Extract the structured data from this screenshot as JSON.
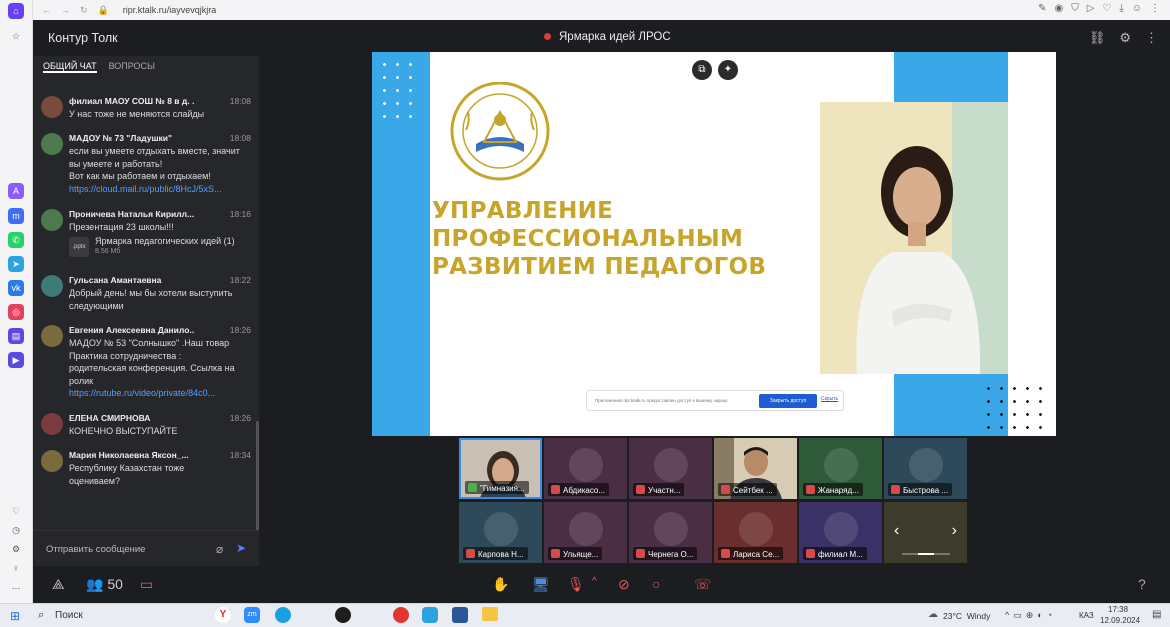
{
  "browser": {
    "url": "ripr.ktalk.ru/iayvevqjkjra"
  },
  "app": {
    "name": "Контур Толк",
    "meeting_title": "Ярмарка идей ЛРОС"
  },
  "chat": {
    "tabs": [
      "ОБЩИЙ ЧАТ",
      "ВОПРОСЫ"
    ],
    "messages": [
      {
        "name": "филиал МАОУ СОШ № 8 в д. ...",
        "time": "18:08",
        "lines": [
          "У нас тоже не меняются слайды"
        ],
        "link": "",
        "avatar_color": "#7a4a3d"
      },
      {
        "name": "МАДОУ № 73 \"Ладушки\"",
        "time": "18:08",
        "lines": [
          "если вы умеете отдыхать вместе, значит",
          "вы умеете и работать!",
          "Вот как мы работаем и отдыхаем!"
        ],
        "link": "https://cloud.mail.ru/public/8HcJ/5xS...",
        "avatar_color": "#4c7a4d"
      },
      {
        "name": "Проничева Наталья Кирилл...",
        "time": "18:16",
        "lines": [
          "Презентация 23 школы!!!"
        ],
        "link": "",
        "avatar_color": "#4c7a4d",
        "attachment": {
          "ext": ".pptx",
          "title": "Ярмарка педагогических идей (1)",
          "size": "8.56 Мб"
        }
      },
      {
        "name": "Гульсана Амантаевна",
        "time": "18:22",
        "lines": [
          "Добрый день! мы бы хотели выступить",
          "следующими"
        ],
        "link": "",
        "avatar_color": "#3d7a78"
      },
      {
        "name": "Евгения Алексеевна Данило...",
        "time": "18:26",
        "lines": [
          "МАДОУ № 53 \"Солнышко\" .Наш товар",
          "Практика сотрудничества :",
          "родительская конференция. Ссылка на",
          "ролик"
        ],
        "link": "https://rutube.ru/video/private/84c0...",
        "avatar_color": "#7a6a3d"
      },
      {
        "name": "ЕЛЕНА СМИРНОВА",
        "time": "18:26",
        "lines": [
          "КОНЕЧНО ВЫСТУПАЙТЕ"
        ],
        "link": "",
        "avatar_color": "#7a3d3d"
      },
      {
        "name": "Мария Николаевна Яксон_...",
        "time": "18:34",
        "lines": [
          "Республику Казахстан тоже",
          "оцениваем?"
        ],
        "link": "",
        "avatar_color": "#7a6a3d"
      }
    ],
    "reactions": [
      "👍",
      "👎",
      "👏",
      "😂",
      "😭",
      "🤩",
      "😞"
    ],
    "send_placeholder": "Отправить сообщение"
  },
  "slide": {
    "title_lines": [
      "УПРАВЛЕНИЕ",
      "ПРОФЕССИОНАЛЬНЫМ",
      "РАЗВИТИЕМ ПЕДАГОГОВ"
    ],
    "seal_text": "С.СЕЙФУЛЛИН АТЫНДАҒЫ ГИМНАЗИЯСЫ КММ",
    "seal_bottom": "СЕЙТБАЕВ КАЛАСЫ",
    "share_notice": "Приложению ripr.ktalk.ru предоставлен доступ к вашему экрану.",
    "close_access": "Закрыть доступ",
    "hide": "Скрыть"
  },
  "participants": [
    {
      "name": "\"Гимназия...",
      "color": "#2d3a4f",
      "mic": "on",
      "video": true,
      "active": true
    },
    {
      "name": "Абдикасо...",
      "color": "#4a2e44",
      "mic": "off"
    },
    {
      "name": "Участн...",
      "color": "#4a2e44",
      "mic": "off"
    },
    {
      "name": "Сейтбек ...",
      "color": "#6b5a46",
      "mic": "off",
      "video": true
    },
    {
      "name": "Жанаряд...",
      "color": "#2f5a3a",
      "mic": "off"
    },
    {
      "name": "Быстрова ...",
      "color": "#2e4a5a",
      "mic": "off"
    },
    {
      "name": "Карпова Н...",
      "color": "#2e4a5a",
      "mic": "off"
    },
    {
      "name": "Ульяще...",
      "color": "#4a2e44",
      "mic": "off"
    },
    {
      "name": "Чернега О...",
      "color": "#4a2e44",
      "mic": "off"
    },
    {
      "name": "Лариса Се...",
      "color": "#6b2e2e",
      "mic": "off"
    },
    {
      "name": "филиал М...",
      "color": "#3a3266",
      "mic": "off"
    }
  ],
  "bottombar": {
    "participants_count": "50"
  },
  "taskbar": {
    "search": "Поиск",
    "weather": "23°C  Windy",
    "lang": "КАЗ",
    "time": "17:38",
    "date": "12.09.2024"
  }
}
